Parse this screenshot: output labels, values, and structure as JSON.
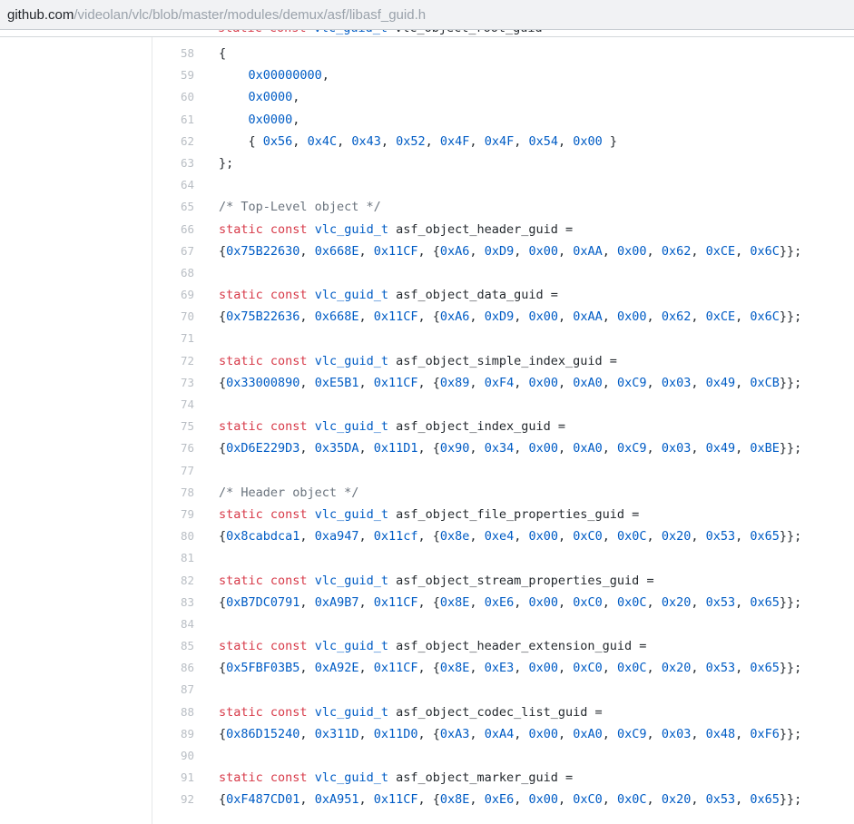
{
  "browser": {
    "url_host": "github.com",
    "url_path": "/videolan/vlc/blob/master/modules/demux/asf/libasf_guid.h"
  },
  "colors": {
    "keyword": "#d73a49",
    "constant_and_type": "#005cc5",
    "comment": "#6a737d",
    "plain_code": "#24292e",
    "line_number": "#b9bec4",
    "addressbar_bg": "#f1f2f4"
  },
  "code": {
    "language": "c",
    "partial_line": {
      "n": 57,
      "t": "static const vlc_guid_t vlc_object_root_guid ="
    },
    "lines": [
      {
        "n": 58,
        "t": "{"
      },
      {
        "n": 59,
        "t": "    0x00000000,"
      },
      {
        "n": 60,
        "t": "    0x0000,"
      },
      {
        "n": 61,
        "t": "    0x0000,"
      },
      {
        "n": 62,
        "t": "    { 0x56, 0x4C, 0x43, 0x52, 0x4F, 0x4F, 0x54, 0x00 }"
      },
      {
        "n": 63,
        "t": "};"
      },
      {
        "n": 64,
        "t": ""
      },
      {
        "n": 65,
        "t": "/* Top-Level object */"
      },
      {
        "n": 66,
        "t": "static const vlc_guid_t asf_object_header_guid ="
      },
      {
        "n": 67,
        "t": "{0x75B22630, 0x668E, 0x11CF, {0xA6, 0xD9, 0x00, 0xAA, 0x00, 0x62, 0xCE, 0x6C}};"
      },
      {
        "n": 68,
        "t": ""
      },
      {
        "n": 69,
        "t": "static const vlc_guid_t asf_object_data_guid ="
      },
      {
        "n": 70,
        "t": "{0x75B22636, 0x668E, 0x11CF, {0xA6, 0xD9, 0x00, 0xAA, 0x00, 0x62, 0xCE, 0x6C}};"
      },
      {
        "n": 71,
        "t": ""
      },
      {
        "n": 72,
        "t": "static const vlc_guid_t asf_object_simple_index_guid ="
      },
      {
        "n": 73,
        "t": "{0x33000890, 0xE5B1, 0x11CF, {0x89, 0xF4, 0x00, 0xA0, 0xC9, 0x03, 0x49, 0xCB}};"
      },
      {
        "n": 74,
        "t": ""
      },
      {
        "n": 75,
        "t": "static const vlc_guid_t asf_object_index_guid ="
      },
      {
        "n": 76,
        "t": "{0xD6E229D3, 0x35DA, 0x11D1, {0x90, 0x34, 0x00, 0xA0, 0xC9, 0x03, 0x49, 0xBE}};"
      },
      {
        "n": 77,
        "t": ""
      },
      {
        "n": 78,
        "t": "/* Header object */"
      },
      {
        "n": 79,
        "t": "static const vlc_guid_t asf_object_file_properties_guid ="
      },
      {
        "n": 80,
        "t": "{0x8cabdca1, 0xa947, 0x11cf, {0x8e, 0xe4, 0x00, 0xC0, 0x0C, 0x20, 0x53, 0x65}};"
      },
      {
        "n": 81,
        "t": ""
      },
      {
        "n": 82,
        "t": "static const vlc_guid_t asf_object_stream_properties_guid ="
      },
      {
        "n": 83,
        "t": "{0xB7DC0791, 0xA9B7, 0x11CF, {0x8E, 0xE6, 0x00, 0xC0, 0x0C, 0x20, 0x53, 0x65}};"
      },
      {
        "n": 84,
        "t": ""
      },
      {
        "n": 85,
        "t": "static const vlc_guid_t asf_object_header_extension_guid ="
      },
      {
        "n": 86,
        "t": "{0x5FBF03B5, 0xA92E, 0x11CF, {0x8E, 0xE3, 0x00, 0xC0, 0x0C, 0x20, 0x53, 0x65}};"
      },
      {
        "n": 87,
        "t": ""
      },
      {
        "n": 88,
        "t": "static const vlc_guid_t asf_object_codec_list_guid ="
      },
      {
        "n": 89,
        "t": "{0x86D15240, 0x311D, 0x11D0, {0xA3, 0xA4, 0x00, 0xA0, 0xC9, 0x03, 0x48, 0xF6}};"
      },
      {
        "n": 90,
        "t": ""
      },
      {
        "n": 91,
        "t": "static const vlc_guid_t asf_object_marker_guid ="
      },
      {
        "n": 92,
        "t": "{0xF487CD01, 0xA951, 0x11CF, {0x8E, 0xE6, 0x00, 0xC0, 0x0C, 0x20, 0x53, 0x65}};"
      }
    ]
  }
}
